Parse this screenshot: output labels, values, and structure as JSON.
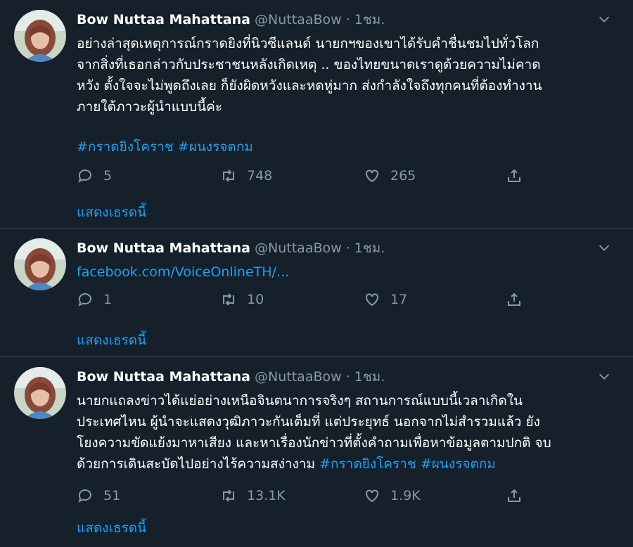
{
  "tweets": [
    {
      "name": "Bow Nuttaa Mahattana",
      "handle": "@NuttaaBow",
      "time": "· 1ชม.",
      "text_lines": [
        "อย่างล่าสุดเหตุการณ์กราดยิงที่นิวซีแลนด์ นายกฯของเขาได้รับคำชื่นชมไปทั่วโลก",
        "จากสิ่งที่เธอกล่าวกับประชาชนหลังเกิดเหตุ .. ของไทยขนาดเราดูด้วยความไม่คาด",
        "หวัง ตั้งใจจะไม่พูดถึงเลย ก็ยังผิดหวังและหดหู่มาก ส่งกำลังใจถึงทุกคนที่ต้องทำงาน",
        "ภายใต้ภาวะผู้นำแบบนี้ค่ะ"
      ],
      "hashtags": "#กราดยิงโคราช #ผนงรจตกม",
      "replies": "5",
      "retweets": "748",
      "likes": "265",
      "show_thread": "แสดงเธรดนี้"
    },
    {
      "name": "Bow Nuttaa Mahattana",
      "handle": "@NuttaaBow",
      "time": "· 1ชม.",
      "link": "facebook.com/VoiceOnlineTH/...",
      "replies": "1",
      "retweets": "10",
      "likes": "17",
      "show_thread": "แสดงเธรดนี้"
    },
    {
      "name": "Bow Nuttaa Mahattana",
      "handle": "@NuttaaBow",
      "time": "· 1ชม.",
      "text_lines": [
        "นายกแถลงข่าวได้แย่อย่างเหนือจินตนาการจริงๆ สถานการณ์แบบนี้เวลาเกิดใน",
        "ประเทศไหน ผู้นำจะแสดงวุฒิภาวะกันเต็มที่ แต่ประยุทธ์ นอกจากไม่สำรวมแล้ว ยัง",
        "โยงความขัดแย้งมาหาเสียง และหาเรื่องนักข่าวที่ตั้งคำถามเพื่อหาข้อมูลตามปกติ จบ",
        "ด้วยการเดินสะบัดไปอย่างไร้ความสง่างาม"
      ],
      "hashtags": "#กราดยิงโคราช #ผนงรจตกม",
      "replies": "51",
      "retweets": "13.1K",
      "likes": "1.9K",
      "show_thread": "แสดงเธรดนี้"
    }
  ],
  "colors": {
    "background": "#15202b",
    "text": "#ffffff",
    "secondary": "#8899a6",
    "link": "#1da1f2",
    "divider": "#38444d"
  },
  "icons": [
    "reply-icon",
    "retweet-icon",
    "like-icon",
    "share-icon",
    "chevron-down-icon"
  ]
}
